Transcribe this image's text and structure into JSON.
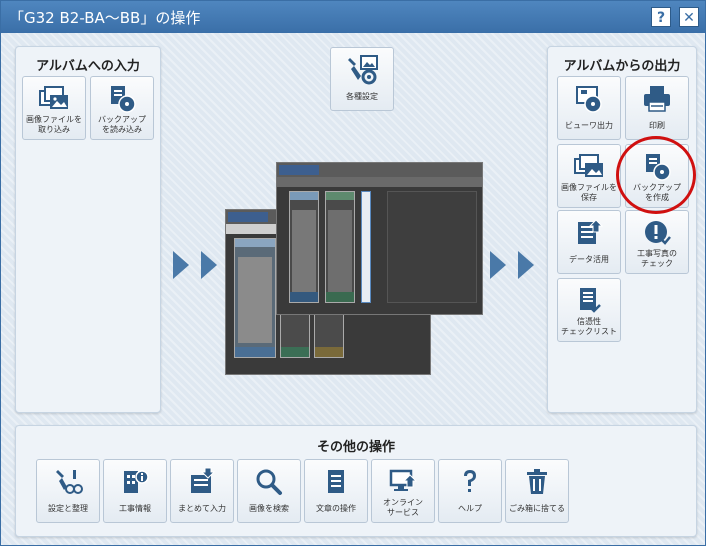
{
  "window": {
    "title": "「G32 B2-BA～BB」の操作",
    "help_glyph": "?",
    "close_glyph": "✕"
  },
  "left_panel": {
    "title": "アルバムへの入力",
    "buttons": [
      {
        "label": "画像ファイルを\n取り込み",
        "icon": "image-files-icon"
      },
      {
        "label": "バックアップ\nを読み込み",
        "icon": "backup-load-icon"
      }
    ]
  },
  "top_center": {
    "button": {
      "label": "各種設定",
      "icon": "settings-tools-icon"
    }
  },
  "right_panel": {
    "title": "アルバムからの出力",
    "buttons": [
      {
        "label": "ビューワ出力",
        "icon": "viewer-output-icon"
      },
      {
        "label": "印刷",
        "icon": "printer-icon"
      },
      {
        "label": "画像ファイルを\n保存",
        "icon": "image-save-icon"
      },
      {
        "label": "バックアップ\nを作成",
        "icon": "backup-create-icon"
      },
      {
        "label": "データ活用",
        "icon": "data-export-icon"
      },
      {
        "label": "工事写真の\nチェック",
        "icon": "photo-check-icon"
      },
      {
        "label": "信憑性\nチェックリスト",
        "icon": "checklist-icon"
      }
    ]
  },
  "bottom_panel": {
    "title": "その他の操作",
    "buttons": [
      {
        "label": "設定と整理",
        "icon": "tools-icon"
      },
      {
        "label": "工事情報",
        "icon": "building-info-icon"
      },
      {
        "label": "まとめて入力",
        "icon": "batch-input-icon"
      },
      {
        "label": "画像を検索",
        "icon": "search-icon"
      },
      {
        "label": "文章の操作",
        "icon": "document-icon"
      },
      {
        "label": "オンライン\nサービス",
        "icon": "online-service-icon"
      },
      {
        "label": "ヘルプ",
        "icon": "help-icon"
      },
      {
        "label": "ごみ箱に捨てる",
        "icon": "trash-icon"
      }
    ]
  },
  "colors": {
    "titlebar": "#3a6fa8",
    "arrow": "#4a79a8",
    "highlight_ring": "#d01010",
    "icon_blue": "#2f5b86"
  }
}
